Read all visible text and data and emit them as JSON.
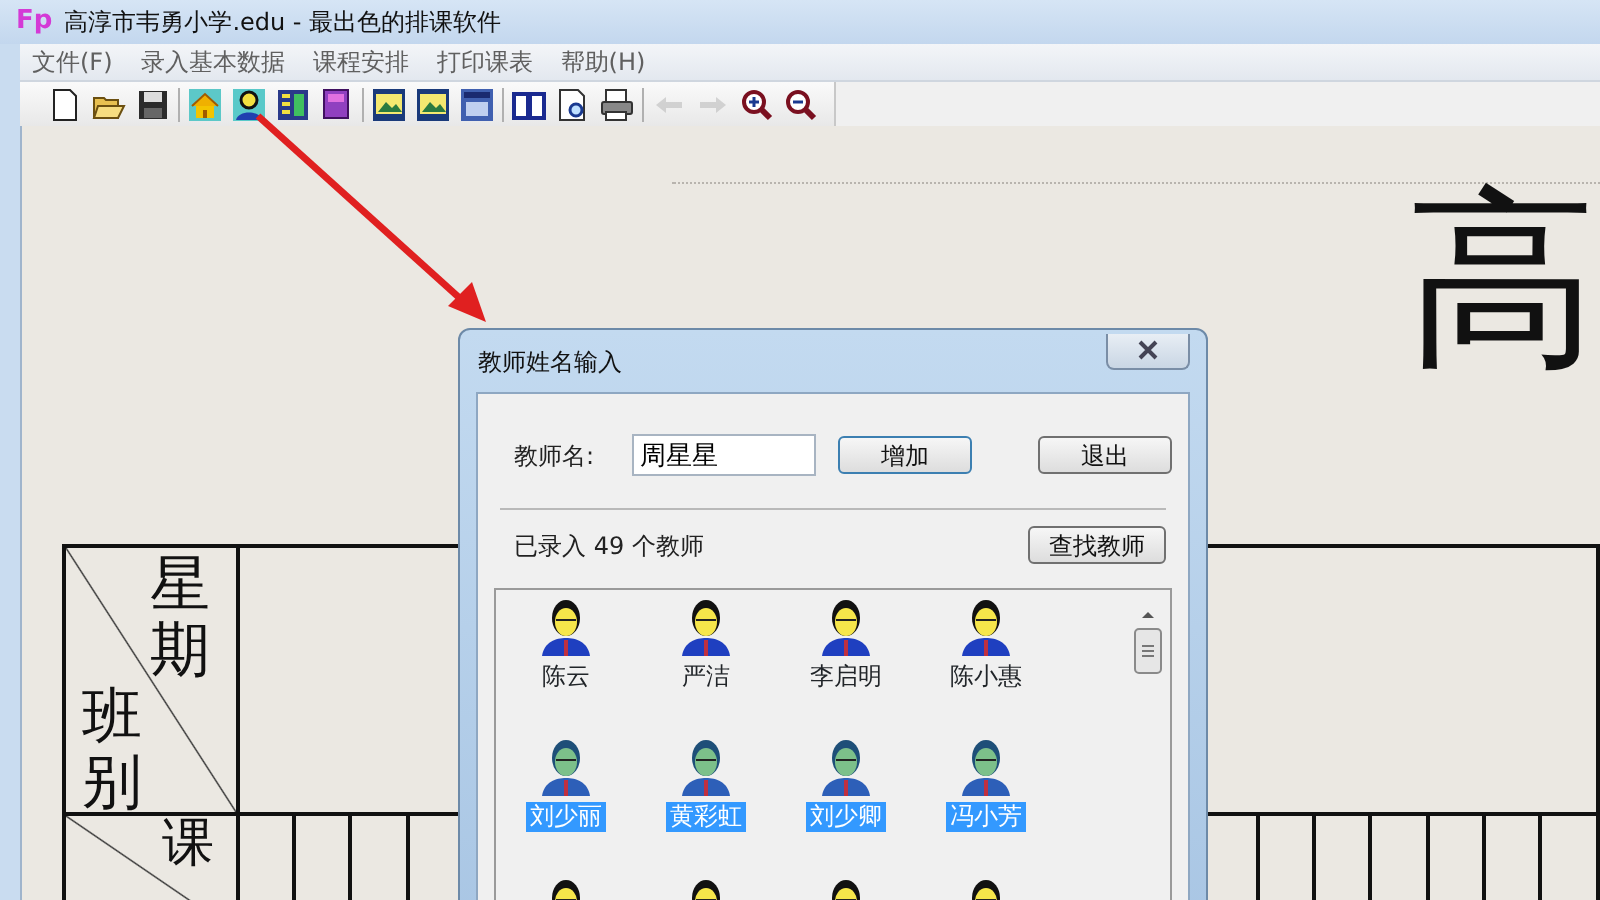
{
  "window": {
    "app_icon": "Fp",
    "title": "高淳市韦勇小学.edu - 最出色的排课软件"
  },
  "menu": [
    "文件(F)",
    "录入基本数据",
    "课程安排",
    "打印课表",
    "帮助(H)"
  ],
  "toolbar": [
    [
      {
        "kind": "new",
        "disabled": false
      },
      {
        "kind": "open",
        "disabled": false
      },
      {
        "kind": "save",
        "disabled": false
      }
    ],
    [
      {
        "kind": "home",
        "disabled": false
      },
      {
        "kind": "teacher",
        "disabled": false
      },
      {
        "kind": "timetable",
        "disabled": false
      },
      {
        "kind": "book",
        "disabled": false
      }
    ],
    [
      {
        "kind": "image",
        "disabled": false
      },
      {
        "kind": "image",
        "disabled": false
      },
      {
        "kind": "window",
        "disabled": false
      }
    ],
    [
      {
        "kind": "open-book",
        "disabled": false
      },
      {
        "kind": "preview",
        "disabled": false
      },
      {
        "kind": "print",
        "disabled": false
      }
    ],
    [
      {
        "kind": "back",
        "disabled": true
      },
      {
        "kind": "forward",
        "disabled": true
      },
      {
        "kind": "zoom-in",
        "disabled": false
      },
      {
        "kind": "zoom-out",
        "disabled": false
      }
    ]
  ],
  "document": {
    "title": "高",
    "table": {
      "corner_top": "星期",
      "corner_bottom": "班别",
      "row_2_header": "课"
    }
  },
  "dialog": {
    "title": "教师姓名输入",
    "name_label": "教师名:",
    "name_value": "周星星",
    "add_button": "增加",
    "exit_button": "退出",
    "count_text": "已录入 49 个教师",
    "find_button": "查找教师",
    "teachers": [
      {
        "name": "陈云",
        "selected": false
      },
      {
        "name": "严洁",
        "selected": false
      },
      {
        "name": "李启明",
        "selected": false
      },
      {
        "name": "陈小惠",
        "selected": false
      },
      {
        "name": "刘少丽",
        "selected": true
      },
      {
        "name": "黄彩虹",
        "selected": true
      },
      {
        "name": "刘少卿",
        "selected": true
      },
      {
        "name": "冯小芳",
        "selected": true
      },
      {
        "selected": false
      },
      {
        "selected": false
      },
      {
        "selected": false
      },
      {
        "selected": false
      }
    ]
  }
}
